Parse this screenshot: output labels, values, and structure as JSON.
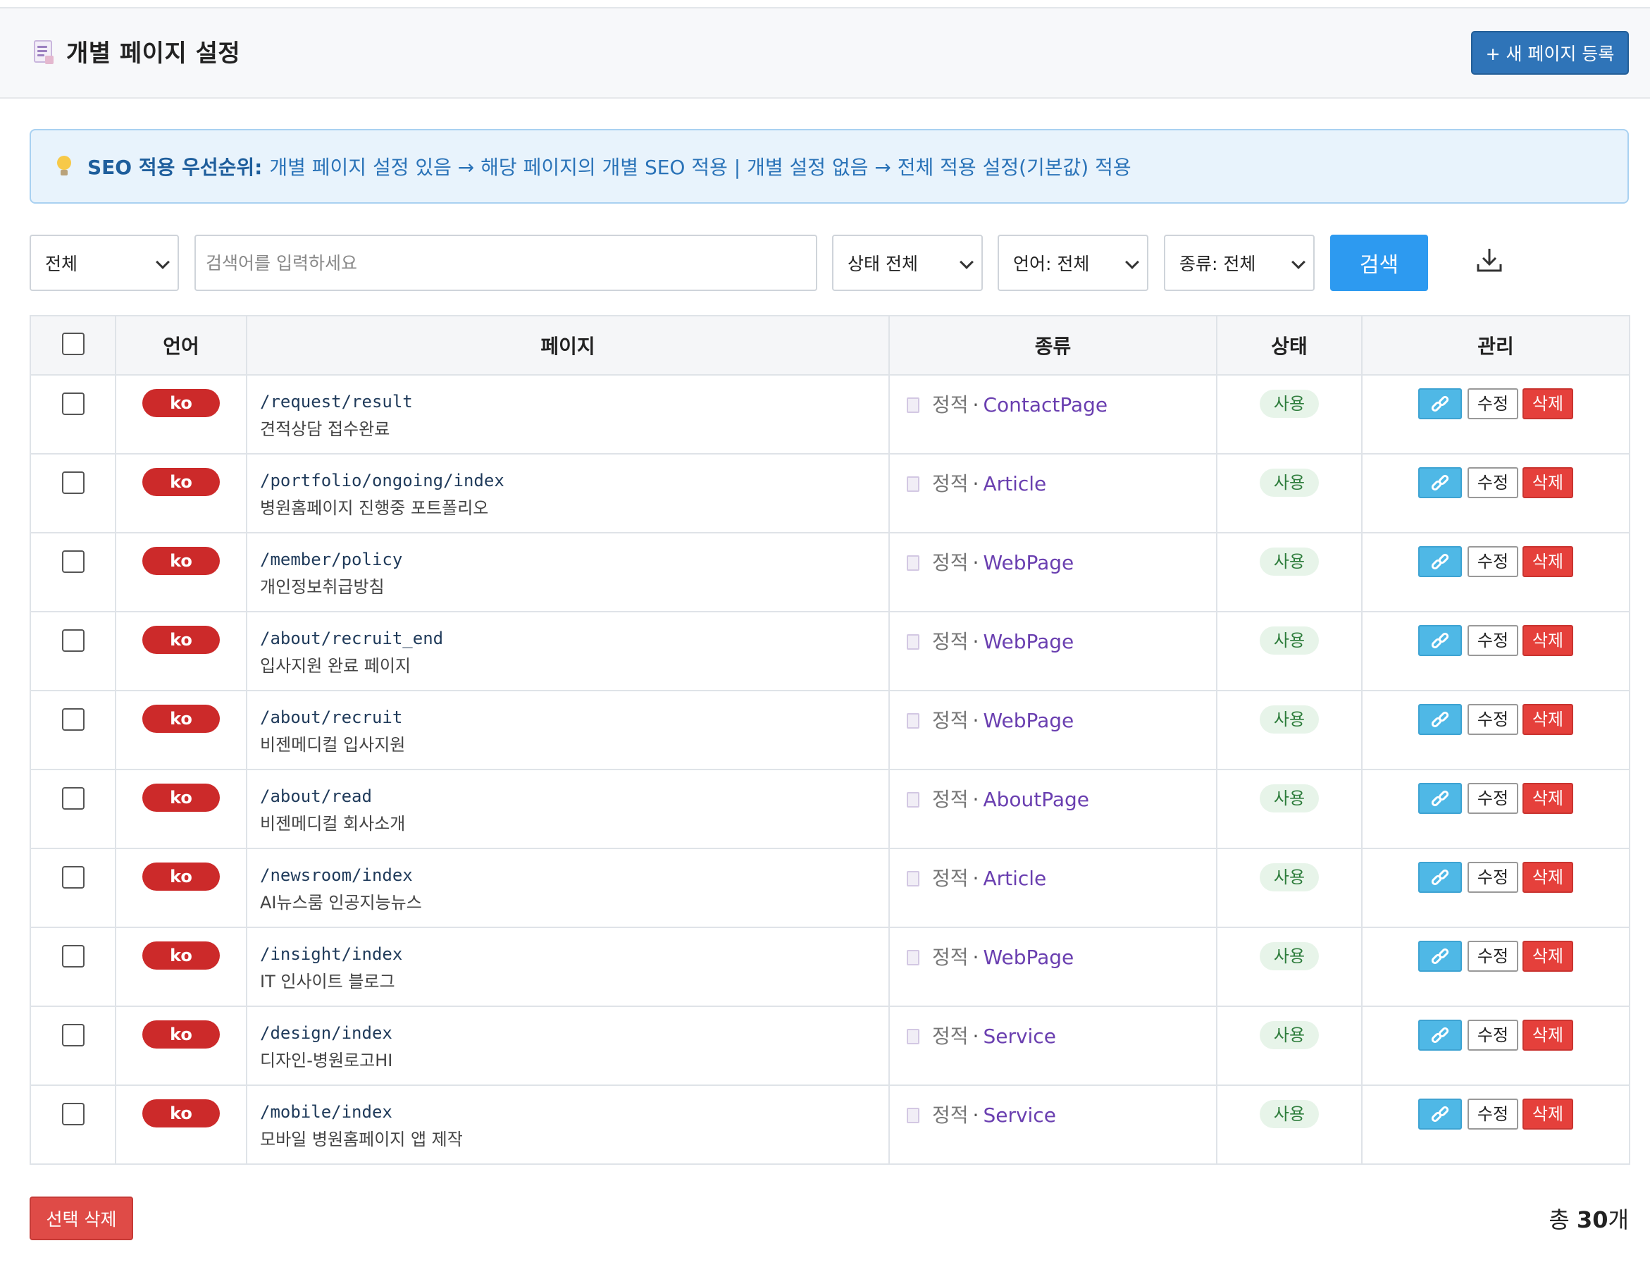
{
  "header": {
    "title": "개별 페이지 설정",
    "new_button": "+ 새 페이지 등록"
  },
  "info": {
    "label": "SEO 적용 우선순위:",
    "text": "개별 페이지 설정 있음 → 해당 페이지의 개별 SEO 적용 | 개별 설정 없음 → 전체 적용 설정(기본값) 적용"
  },
  "filters": {
    "scope": "전체",
    "search_placeholder": "검색어를 입력하세요",
    "status": "상태 전체",
    "language": "언어: 전체",
    "type": "종류: 전체",
    "search_button": "검색"
  },
  "table": {
    "headers": {
      "language": "언어",
      "page": "페이지",
      "type": "종류",
      "status": "상태",
      "manage": "관리"
    },
    "rows": [
      {
        "lang": "ko",
        "path": "/request/result",
        "name": "견적상담 접수완료",
        "type_static": "정적",
        "type_sep": "·",
        "type_schema": "ContactPage",
        "status": "사용",
        "edit": "수정",
        "delete": "삭제"
      },
      {
        "lang": "ko",
        "path": "/portfolio/ongoing/index",
        "name": "병원홈페이지 진행중 포트폴리오",
        "type_static": "정적",
        "type_sep": "·",
        "type_schema": "Article",
        "status": "사용",
        "edit": "수정",
        "delete": "삭제"
      },
      {
        "lang": "ko",
        "path": "/member/policy",
        "name": "개인정보취급방침",
        "type_static": "정적",
        "type_sep": "·",
        "type_schema": "WebPage",
        "status": "사용",
        "edit": "수정",
        "delete": "삭제"
      },
      {
        "lang": "ko",
        "path": "/about/recruit_end",
        "name": "입사지원 완료 페이지",
        "type_static": "정적",
        "type_sep": "·",
        "type_schema": "WebPage",
        "status": "사용",
        "edit": "수정",
        "delete": "삭제"
      },
      {
        "lang": "ko",
        "path": "/about/recruit",
        "name": "비젠메디컬 입사지원",
        "type_static": "정적",
        "type_sep": "·",
        "type_schema": "WebPage",
        "status": "사용",
        "edit": "수정",
        "delete": "삭제"
      },
      {
        "lang": "ko",
        "path": "/about/read",
        "name": "비젠메디컬 회사소개",
        "type_static": "정적",
        "type_sep": "·",
        "type_schema": "AboutPage",
        "status": "사용",
        "edit": "수정",
        "delete": "삭제"
      },
      {
        "lang": "ko",
        "path": "/newsroom/index",
        "name": "AI뉴스룸 인공지능뉴스",
        "type_static": "정적",
        "type_sep": "·",
        "type_schema": "Article",
        "status": "사용",
        "edit": "수정",
        "delete": "삭제"
      },
      {
        "lang": "ko",
        "path": "/insight/index",
        "name": "IT 인사이트 블로그",
        "type_static": "정적",
        "type_sep": "·",
        "type_schema": "WebPage",
        "status": "사용",
        "edit": "수정",
        "delete": "삭제"
      },
      {
        "lang": "ko",
        "path": "/design/index",
        "name": "디자인-병원로고HI",
        "type_static": "정적",
        "type_sep": "·",
        "type_schema": "Service",
        "status": "사용",
        "edit": "수정",
        "delete": "삭제"
      },
      {
        "lang": "ko",
        "path": "/mobile/index",
        "name": "모바일 병원홈페이지 앱 제작",
        "type_static": "정적",
        "type_sep": "·",
        "type_schema": "Service",
        "status": "사용",
        "edit": "수정",
        "delete": "삭제"
      }
    ]
  },
  "footer": {
    "bulk_delete": "선택 삭제",
    "total_prefix": "총 ",
    "total_count": "30",
    "total_suffix": "개"
  },
  "colors": {
    "primary": "#2f74b8",
    "search": "#2d9af0",
    "danger": "#e5403b",
    "lang_badge": "#cc2a2a",
    "status_bg": "#e7f4e9",
    "status_text": "#2e7d3c",
    "schema_text": "#6a3fb0",
    "info_bg": "#e8f3fc"
  },
  "icons": {
    "title": "document-icon",
    "info": "lightbulb-icon",
    "download": "download-icon",
    "link": "link-icon",
    "type": "document-icon"
  }
}
